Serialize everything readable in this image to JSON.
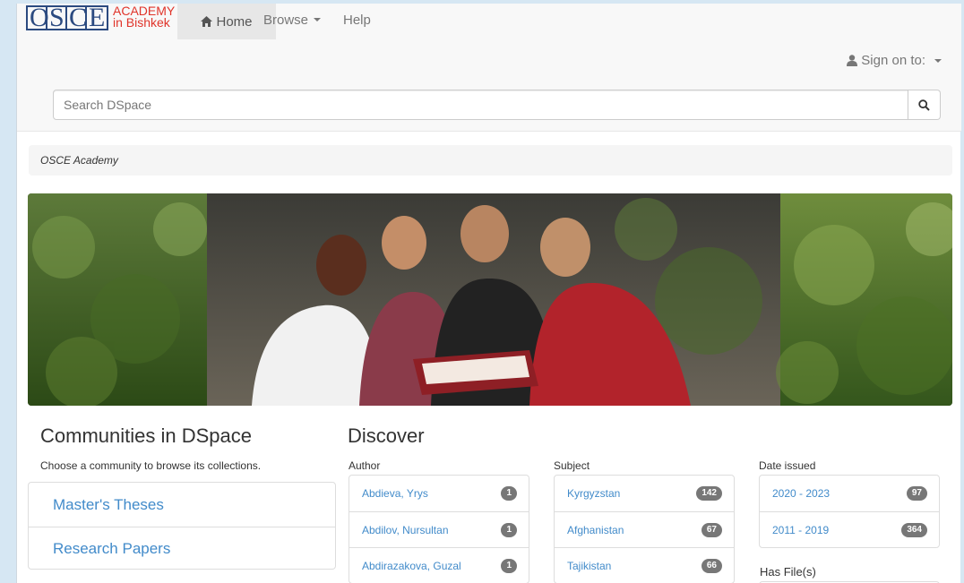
{
  "brand": {
    "letters": [
      "O",
      "S",
      "C",
      "E"
    ],
    "line1": "ACADEMY",
    "line2": "in Bishkek"
  },
  "nav": {
    "home": "Home",
    "browse": "Browse",
    "help": "Help",
    "sign_on": "Sign on to:"
  },
  "search": {
    "placeholder": "Search DSpace"
  },
  "breadcrumb": "OSCE Academy",
  "communities": {
    "title": "Communities in DSpace",
    "description": "Choose a community to browse its collections.",
    "items": [
      "Master's Theses",
      "Research Papers"
    ]
  },
  "discover": {
    "title": "Discover",
    "facets": [
      {
        "label": "Author",
        "items": [
          {
            "name": "Abdieva, Yrys",
            "count": "1"
          },
          {
            "name": "Abdilov, Nursultan",
            "count": "1"
          },
          {
            "name": "Abdirazakova, Guzal",
            "count": "1"
          }
        ]
      },
      {
        "label": "Subject",
        "items": [
          {
            "name": "Kyrgyzstan",
            "count": "142"
          },
          {
            "name": "Afghanistan",
            "count": "67"
          },
          {
            "name": "Tajikistan",
            "count": "66"
          }
        ]
      },
      {
        "label": "Date issued",
        "items": [
          {
            "name": "2020 - 2023",
            "count": "97"
          },
          {
            "name": "2011 - 2019",
            "count": "364"
          }
        ]
      }
    ],
    "has_file_label": "Has File(s)"
  },
  "colors": {
    "link": "#428bca",
    "badge": "#777777",
    "brand_blue": "#2b4a80",
    "brand_red": "#e0342a"
  }
}
